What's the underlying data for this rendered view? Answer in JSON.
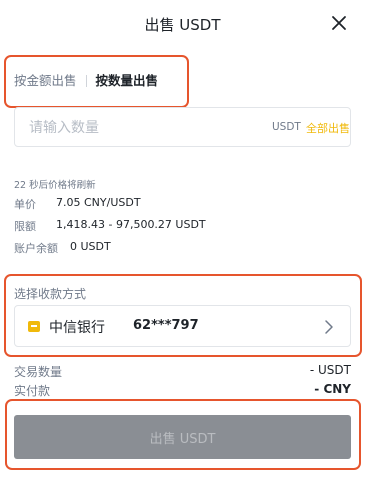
{
  "header": {
    "title": "出售 USDT",
    "close_icon": "close-icon"
  },
  "tabs": [
    {
      "label": "按金额出售",
      "active": false
    },
    {
      "label": "按数量出售",
      "active": true
    }
  ],
  "amount": {
    "placeholder": "请输入数量",
    "value": "",
    "unit": "USDT",
    "all_label": "全部出售"
  },
  "info": {
    "refresh_note": "22 秒后价格将刷新",
    "price_label": "单价",
    "price_value": "7.05 CNY/USDT",
    "limit_label": "限额",
    "limit_value": "1,418.43 - 97,500.27 USDT",
    "balance_label": "账户余额",
    "balance_value": "0 USDT"
  },
  "payment": {
    "label": "选择收款方式",
    "bank_name": "中信银行",
    "account": "62***797",
    "bank_icon": "bank-card-icon",
    "chevron_icon": "chevron-right-icon"
  },
  "summary": {
    "quantity_label": "交易数量",
    "quantity_value": "- USDT",
    "payout_label": "实付款",
    "payout_value": "- CNY"
  },
  "submit": {
    "label": "出售 USDT"
  },
  "colors": {
    "accent": "#f0b90b",
    "highlight_border": "#e6552d",
    "disabled_button": "#8a8e94"
  }
}
